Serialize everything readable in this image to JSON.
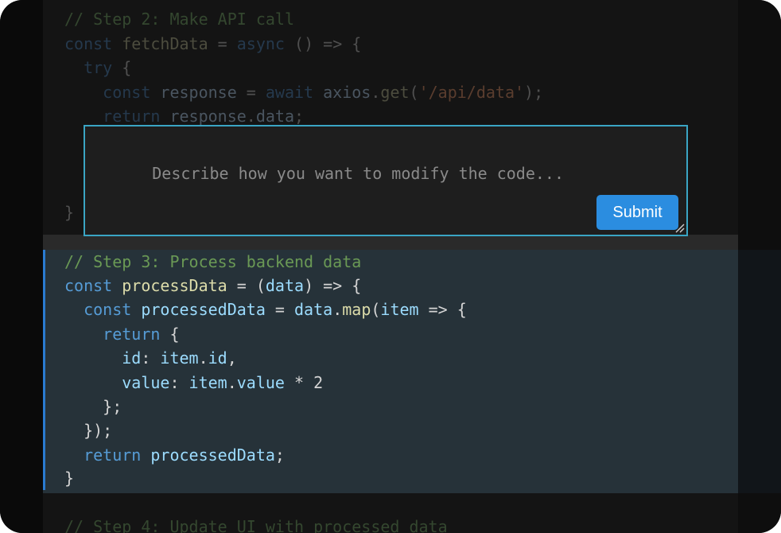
{
  "editor": {
    "lines_before": [
      {
        "tokens": [
          {
            "t": "// Step 2: Make API call",
            "c": "c"
          }
        ]
      },
      {
        "tokens": [
          {
            "t": "const",
            "c": "k"
          },
          {
            "t": " ",
            "c": "p"
          },
          {
            "t": "fetchData",
            "c": "f"
          },
          {
            "t": " = ",
            "c": "p"
          },
          {
            "t": "async",
            "c": "k"
          },
          {
            "t": " () => {",
            "c": "p"
          }
        ]
      },
      {
        "tokens": [
          {
            "t": "  try",
            "c": "k"
          },
          {
            "t": " {",
            "c": "p"
          }
        ]
      },
      {
        "tokens": [
          {
            "t": "    const",
            "c": "k"
          },
          {
            "t": " ",
            "c": "p"
          },
          {
            "t": "response",
            "c": "i"
          },
          {
            "t": " = ",
            "c": "p"
          },
          {
            "t": "await",
            "c": "k"
          },
          {
            "t": " ",
            "c": "p"
          },
          {
            "t": "axios",
            "c": "i"
          },
          {
            "t": ".",
            "c": "p"
          },
          {
            "t": "get",
            "c": "f"
          },
          {
            "t": "(",
            "c": "p"
          },
          {
            "t": "'/api/data'",
            "c": "s"
          },
          {
            "t": ");",
            "c": "p"
          }
        ]
      },
      {
        "tokens": [
          {
            "t": "    return",
            "c": "k"
          },
          {
            "t": " ",
            "c": "p"
          },
          {
            "t": "response",
            "c": "i"
          },
          {
            "t": ".",
            "c": "p"
          },
          {
            "t": "data",
            "c": "i"
          },
          {
            "t": ";",
            "c": "p"
          }
        ]
      },
      {
        "tokens": [
          {
            "t": "}",
            "c": "p"
          }
        ]
      }
    ],
    "highlighted_lines": [
      {
        "tokens": [
          {
            "t": "// Step 3: Process backend data",
            "c": "c"
          }
        ]
      },
      {
        "tokens": [
          {
            "t": "const",
            "c": "k"
          },
          {
            "t": " ",
            "c": "p"
          },
          {
            "t": "processData",
            "c": "f"
          },
          {
            "t": " = (",
            "c": "p"
          },
          {
            "t": "data",
            "c": "i"
          },
          {
            "t": ") => {",
            "c": "p"
          }
        ]
      },
      {
        "tokens": [
          {
            "t": "  const",
            "c": "k"
          },
          {
            "t": " ",
            "c": "p"
          },
          {
            "t": "processedData",
            "c": "i"
          },
          {
            "t": " = ",
            "c": "p"
          },
          {
            "t": "data",
            "c": "i"
          },
          {
            "t": ".",
            "c": "p"
          },
          {
            "t": "map",
            "c": "f"
          },
          {
            "t": "(",
            "c": "p"
          },
          {
            "t": "item",
            "c": "i"
          },
          {
            "t": " => {",
            "c": "p"
          }
        ]
      },
      {
        "tokens": [
          {
            "t": "    return",
            "c": "k"
          },
          {
            "t": " {",
            "c": "p"
          }
        ]
      },
      {
        "tokens": [
          {
            "t": "      id",
            "c": "i"
          },
          {
            "t": ": ",
            "c": "p"
          },
          {
            "t": "item",
            "c": "i"
          },
          {
            "t": ".",
            "c": "p"
          },
          {
            "t": "id",
            "c": "i"
          },
          {
            "t": ",",
            "c": "p"
          }
        ]
      },
      {
        "tokens": [
          {
            "t": "      value",
            "c": "i"
          },
          {
            "t": ": ",
            "c": "p"
          },
          {
            "t": "item",
            "c": "i"
          },
          {
            "t": ".",
            "c": "p"
          },
          {
            "t": "value",
            "c": "i"
          },
          {
            "t": " * ",
            "c": "p"
          },
          {
            "t": "2",
            "c": "n"
          }
        ]
      },
      {
        "tokens": [
          {
            "t": "    };",
            "c": "p"
          }
        ]
      },
      {
        "tokens": [
          {
            "t": "  });",
            "c": "p"
          }
        ]
      },
      {
        "tokens": [
          {
            "t": "  return",
            "c": "k"
          },
          {
            "t": " ",
            "c": "p"
          },
          {
            "t": "processedData",
            "c": "i"
          },
          {
            "t": ";",
            "c": "p"
          }
        ]
      },
      {
        "tokens": [
          {
            "t": "}",
            "c": "p"
          }
        ]
      }
    ],
    "lines_after": [
      {
        "tokens": [
          {
            "t": "// Step 4: Update UI with processed data",
            "c": "c"
          }
        ]
      }
    ]
  },
  "popup": {
    "placeholder": "Describe how you want to modify the code...",
    "submit_label": "Submit"
  },
  "colors": {
    "accent": "#2a7bd1",
    "submit": "#2b8de0",
    "popup_border": "#3aa5c4",
    "highlight_bg": "#263239"
  }
}
